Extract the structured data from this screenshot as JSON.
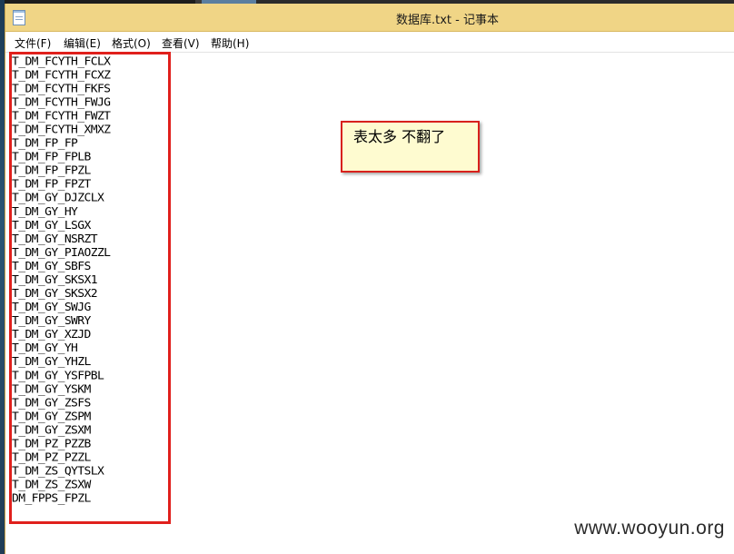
{
  "window": {
    "title": "数据库.txt - 记事本",
    "icon": "notepad-icon"
  },
  "menu": [
    {
      "id": "file",
      "label": "文件(F)"
    },
    {
      "id": "edit",
      "label": "编辑(E)"
    },
    {
      "id": "format",
      "label": "格式(O)"
    },
    {
      "id": "view",
      "label": "查看(V)"
    },
    {
      "id": "help",
      "label": "帮助(H)"
    }
  ],
  "document": {
    "lines": [
      "T_DM_FCYTH_FCLX",
      "T_DM_FCYTH_FCXZ",
      "T_DM_FCYTH_FKFS",
      "T_DM_FCYTH_FWJG",
      "T_DM_FCYTH_FWZT",
      "T_DM_FCYTH_XMXZ",
      "T_DM_FP_FP",
      "T_DM_FP_FPLB",
      "T_DM_FP_FPZL",
      "T_DM_FP_FPZT",
      "T_DM_GY_DJZCLX",
      "T_DM_GY_HY",
      "T_DM_GY_LSGX",
      "T_DM_GY_NSRZT",
      "T_DM_GY_PIAOZZL",
      "T_DM_GY_SBFS",
      "T_DM_GY_SKSX1",
      "T_DM_GY_SKSX2",
      "T_DM_GY_SWJG",
      "T_DM_GY_SWRY",
      "T_DM_GY_XZJD",
      "T_DM_GY_YH",
      "T_DM_GY_YHZL",
      "T_DM_GY_YSFPBL",
      "T_DM_GY_YSKM",
      "T_DM_GY_ZSFS",
      "T_DM_GY_ZSPM",
      "T_DM_GY_ZSXM",
      "T_DM_PZ_PZZB",
      "T_DM_PZ_PZZL",
      "T_DM_ZS_QYTSLX",
      "T_DM_ZS_ZSXW",
      "DM_FPPS_FPZL"
    ]
  },
  "annotation": {
    "note_text": "表太多 不翻了",
    "box_color": "#e0201c",
    "note_background": "#fefbd0"
  },
  "watermark": "www.wooyun.org",
  "colors": {
    "titlebar": "#f0d586",
    "highlight": "#e0201c"
  }
}
